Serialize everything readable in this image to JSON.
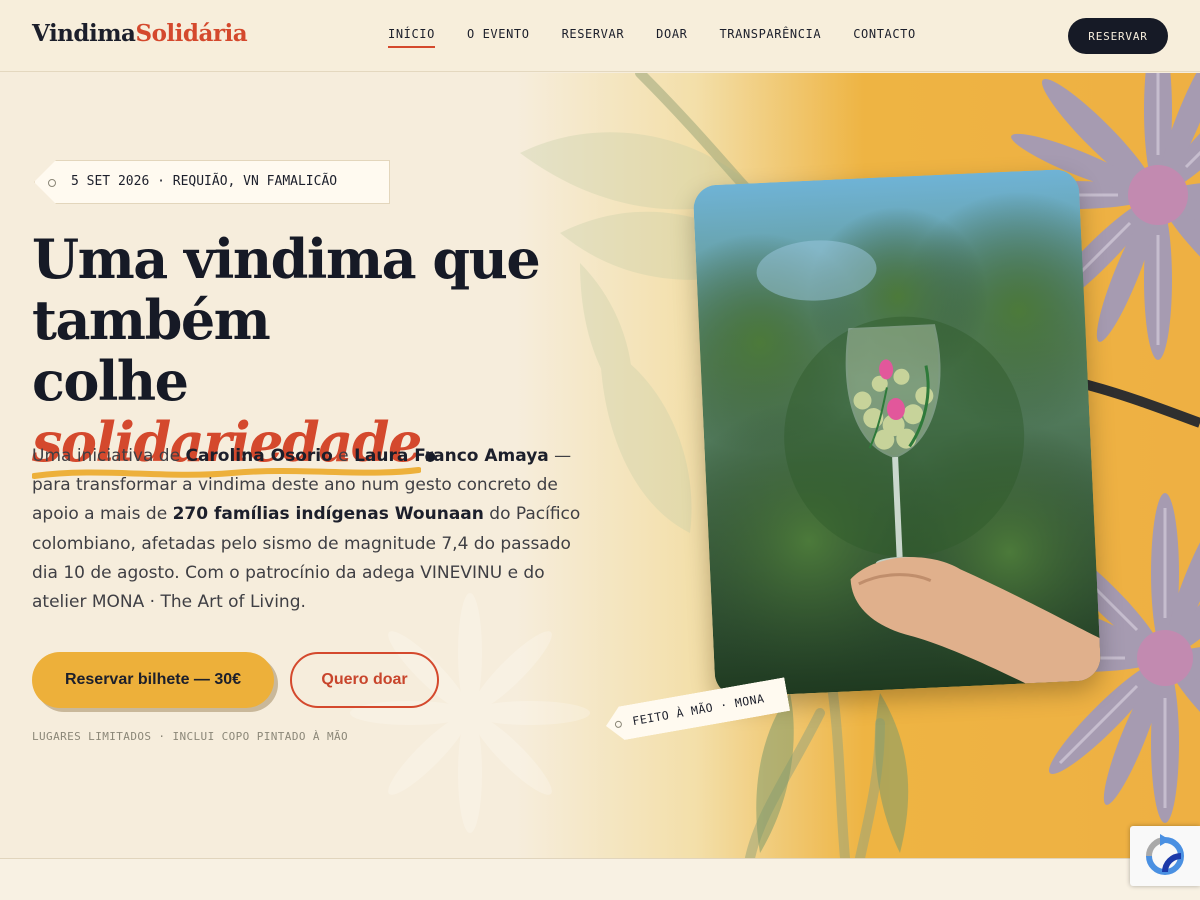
{
  "brand": {
    "part1": "Vindima",
    "part2": "Solidária"
  },
  "nav": [
    {
      "label": "INÍCIO",
      "active": true
    },
    {
      "label": "O EVENTO"
    },
    {
      "label": "RESERVAR"
    },
    {
      "label": "DOAR"
    },
    {
      "label": "TRANSPARÊNCIA"
    },
    {
      "label": "CONTACTO"
    }
  ],
  "header_cta": "RESERVAR",
  "hero": {
    "date_tag": "5 SET 2026 · REQUIÃO, VN FAMALICÃO",
    "headline_line1": "Uma vindima que",
    "headline_line2": "também",
    "headline_line3_start": "colhe ",
    "headline_highlight": "solidariedade",
    "headline_end": ".",
    "intro": {
      "t1": "Uma iniciativa de ",
      "name1": "Carolina Osorio",
      "t2": " e ",
      "name2": "Laura Franco Amaya",
      "t3": " — para transformar a vindima deste ano num gesto concreto de apoio a mais de ",
      "highlight": "270 famílias indígenas Wounaan",
      "t4": " do Pacífico colombiano, afetadas pelo sismo de magnitude 7,4 do passado dia 10 de agosto. Com o patrocínio da adega VINEVINU e do atelier MONA · The Art of Living."
    },
    "primary_cta": "Reservar bilhete — 30€",
    "secondary_cta": "Quero doar",
    "note": "LUGARES LIMITADOS · INCLUI COPO PINTADO À MÃO",
    "photo_tag": "FEITO À MÃO · MONA"
  },
  "colors": {
    "accent_red": "#d4492d",
    "accent_yellow": "#edb03a",
    "ink": "#161a26",
    "cream": "#f6eddc"
  },
  "icons": {
    "recaptcha": "recaptcha-icon"
  }
}
